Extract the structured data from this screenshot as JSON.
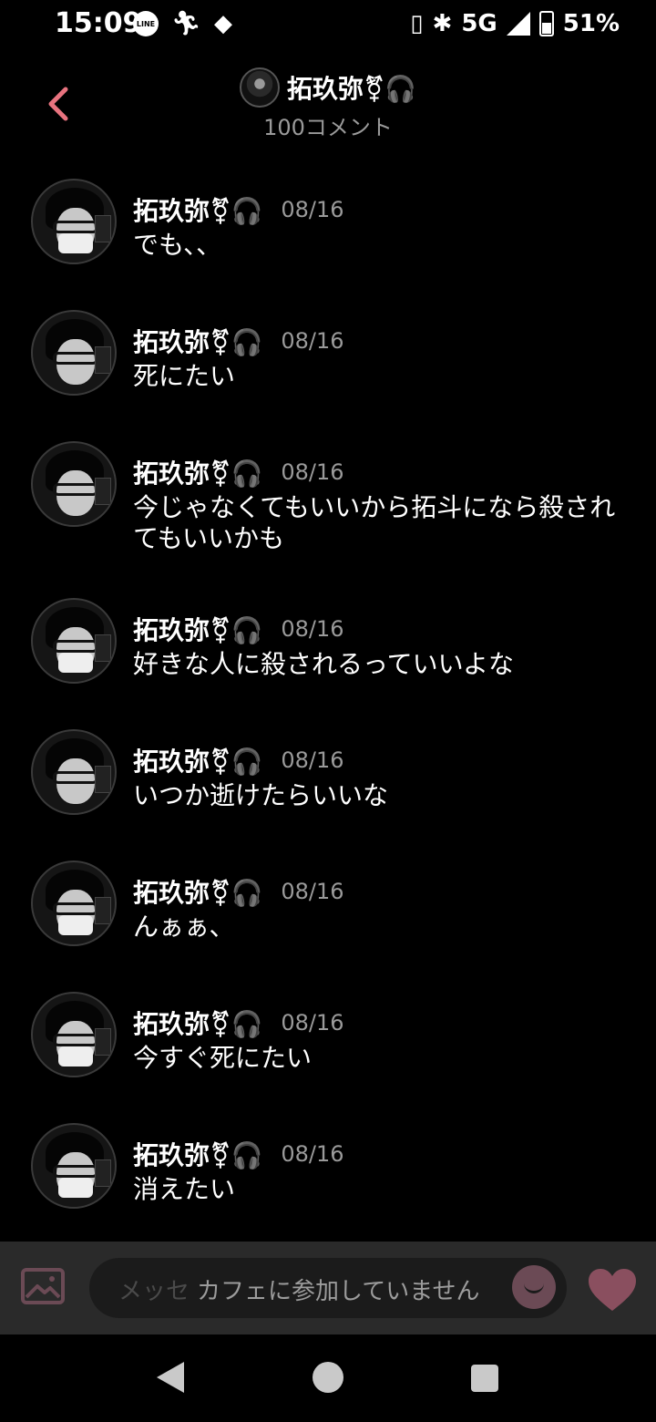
{
  "status_bar": {
    "time": "15:09",
    "line_badge": "LINE",
    "icons_left": [
      "line-icon",
      "running-icon",
      "diamond-icon"
    ],
    "network": "5G",
    "battery_percent": "51%",
    "battery_level": 0.51
  },
  "header": {
    "back_icon": "chevron-left-icon",
    "title": "拓玖弥⚧🎧",
    "comment_count": "100コメント"
  },
  "comments": [
    {
      "name": "拓玖弥⚧🎧",
      "date": "08/16",
      "text": "でも、、"
    },
    {
      "name": "拓玖弥⚧🎧",
      "date": "08/16",
      "text": "死にたい"
    },
    {
      "name": "拓玖弥⚧🎧",
      "date": "08/16",
      "text": "今じゃなくてもいいから拓斗になら殺されてもいいかも"
    },
    {
      "name": "拓玖弥⚧🎧",
      "date": "08/16",
      "text": "好きな人に殺されるっていいよな"
    },
    {
      "name": "拓玖弥⚧🎧",
      "date": "08/16",
      "text": "いつか逝けたらいいな"
    },
    {
      "name": "拓玖弥⚧🎧",
      "date": "08/16",
      "text": "んぁぁ、"
    },
    {
      "name": "拓玖弥⚧🎧",
      "date": "08/16",
      "text": "今すぐ死にたい"
    },
    {
      "name": "拓玖弥⚧🎧",
      "date": "08/16",
      "text": "消えたい"
    }
  ],
  "input_bar": {
    "placeholder": "メッセ",
    "notice": "カフェに参加していません",
    "image_icon": "image-icon",
    "emoji_icon": "smile-icon",
    "like_icon": "heart-icon"
  },
  "nav_bar": {
    "icons": [
      "back-triangle-icon",
      "home-circle-icon",
      "recents-square-icon"
    ]
  },
  "colors": {
    "background": "#000000",
    "accent": "#e8737f",
    "secondary_text": "#9a9a9a",
    "input_bar": "#2a2a2a",
    "heart": "#8a4f5f"
  }
}
